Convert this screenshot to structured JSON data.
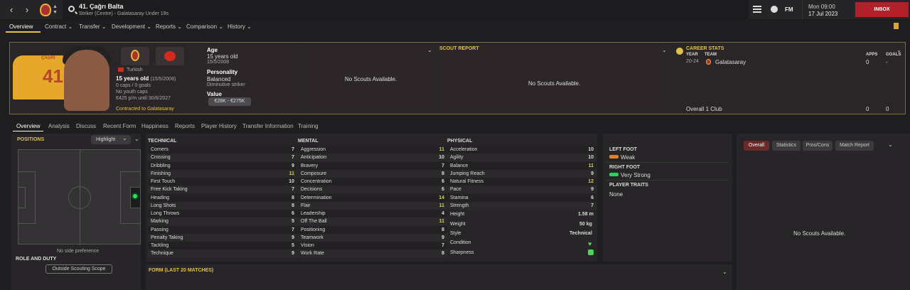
{
  "header": {
    "player_title": "41. Çağrı Balta",
    "player_subtitle": "Striker (Centre) - Galatasaray Under 19s",
    "fm_label": "FM",
    "date_day": "Mon 09:00",
    "date": "17 Jul 2023",
    "inbox_label": "INBOX"
  },
  "tabs": [
    "Overview",
    "Contract",
    "Transfer",
    "Development",
    "Reports",
    "Comparison",
    "History"
  ],
  "profile": {
    "shirt_name": "ÇAĞRI",
    "shirt_number": "41",
    "nationality": "Turkish",
    "age_line": "15 years old",
    "dob_short": "(15/5/2008)",
    "caps_goals": "0 caps / 0 goals",
    "youth_caps": "No youth caps",
    "wage_contract": "€425 p/m until 30/6/2027",
    "contract_status": "Contracted to Galatasaray",
    "age_label": "Age",
    "age_value": "15 years old",
    "age_dob": "15/5/2008",
    "personality_label": "Personality",
    "personality_value": "Balanced",
    "personality_desc": "Diminutive striker",
    "value_label": "Value",
    "value_range": "€28K - €275K",
    "scouts_none": "No Scouts Available.",
    "scout_report_label": "SCOUT REPORT",
    "scout_report_none": "No Scouts Available."
  },
  "career": {
    "title": "CAREER STATS",
    "col_year": "YEAR",
    "col_team": "TEAM",
    "col_apps": "APPS",
    "col_goals": "GOALS",
    "row_year": "20-24",
    "row_team": "Galatasaray",
    "row_apps": "0",
    "row_goals": "-",
    "overall_label": "Overall 1 Club",
    "overall_apps": "0",
    "overall_goals": "0"
  },
  "subtabs": [
    "Overview",
    "Analysis",
    "Discuss",
    "Recent Form",
    "Happiness",
    "Reports",
    "Player History",
    "Transfer Information",
    "Training"
  ],
  "positions": {
    "label": "POSITIONS",
    "highlight": "Highlight",
    "side_pref": "No side preference",
    "role_label": "ROLE AND DUTY",
    "scope_button": "Outside Scouting Scope"
  },
  "technical": {
    "header": "TECHNICAL",
    "rows": [
      {
        "name": "Corners",
        "value": "7",
        "hl": false
      },
      {
        "name": "Crossing",
        "value": "7",
        "hl": false
      },
      {
        "name": "Dribbling",
        "value": "9",
        "hl": false
      },
      {
        "name": "Finishing",
        "value": "11",
        "hl": true
      },
      {
        "name": "First Touch",
        "value": "10",
        "hl": false
      },
      {
        "name": "Free Kick Taking",
        "value": "7",
        "hl": false
      },
      {
        "name": "Heading",
        "value": "8",
        "hl": false
      },
      {
        "name": "Long Shots",
        "value": "8",
        "hl": false
      },
      {
        "name": "Long Throws",
        "value": "6",
        "hl": false
      },
      {
        "name": "Marking",
        "value": "5",
        "hl": false
      },
      {
        "name": "Passing",
        "value": "7",
        "hl": false
      },
      {
        "name": "Penalty Taking",
        "value": "9",
        "hl": false
      },
      {
        "name": "Tackling",
        "value": "5",
        "hl": false
      },
      {
        "name": "Technique",
        "value": "9",
        "hl": false
      }
    ]
  },
  "mental": {
    "header": "MENTAL",
    "rows": [
      {
        "name": "Aggression",
        "value": "11",
        "hl": true
      },
      {
        "name": "Anticipation",
        "value": "10",
        "hl": false
      },
      {
        "name": "Bravery",
        "value": "7",
        "hl": false
      },
      {
        "name": "Composure",
        "value": "8",
        "hl": false
      },
      {
        "name": "Concentration",
        "value": "6",
        "hl": false
      },
      {
        "name": "Decisions",
        "value": "6",
        "hl": false
      },
      {
        "name": "Determination",
        "value": "14",
        "hl": true
      },
      {
        "name": "Flair",
        "value": "11",
        "hl": true
      },
      {
        "name": "Leadership",
        "value": "4",
        "hl": false
      },
      {
        "name": "Off The Ball",
        "value": "11",
        "hl": true
      },
      {
        "name": "Positioning",
        "value": "8",
        "hl": false
      },
      {
        "name": "Teamwork",
        "value": "9",
        "hl": false
      },
      {
        "name": "Vision",
        "value": "7",
        "hl": false
      },
      {
        "name": "Work Rate",
        "value": "8",
        "hl": false
      }
    ]
  },
  "physical": {
    "header": "PHYSICAL",
    "rows": [
      {
        "name": "Acceleration",
        "value": "10",
        "hl": false
      },
      {
        "name": "Agility",
        "value": "10",
        "hl": false
      },
      {
        "name": "Balance",
        "value": "11",
        "hl": true
      },
      {
        "name": "Jumping Reach",
        "value": "9",
        "hl": false
      },
      {
        "name": "Natural Fitness",
        "value": "12",
        "hl": true
      },
      {
        "name": "Pace",
        "value": "9",
        "hl": false
      },
      {
        "name": "Stamina",
        "value": "6",
        "hl": false
      },
      {
        "name": "Strength",
        "value": "7",
        "hl": false
      }
    ],
    "height_label": "Height",
    "height_value": "1.58 m",
    "weight_label": "Weight",
    "weight_value": "50 kg",
    "style_label": "Style",
    "style_value": "Technical",
    "condition_label": "Condition",
    "sharpness_label": "Sharpness"
  },
  "feet": {
    "left_label": "LEFT FOOT",
    "left_value": "Weak",
    "right_label": "RIGHT FOOT",
    "right_value": "Very Strong",
    "traits_label": "PLAYER TRAITS",
    "traits_value": "None"
  },
  "reports": {
    "tabs": [
      "Overall",
      "Statistics",
      "Pros/Cons",
      "Match Report"
    ],
    "none": "No Scouts Available."
  },
  "form": {
    "label": "FORM (LAST 20 MATCHES)"
  },
  "colors": {
    "accent_gold": "#e2c04c",
    "highlight_green": "#d2d24e",
    "inbox_red": "#b3202a"
  }
}
